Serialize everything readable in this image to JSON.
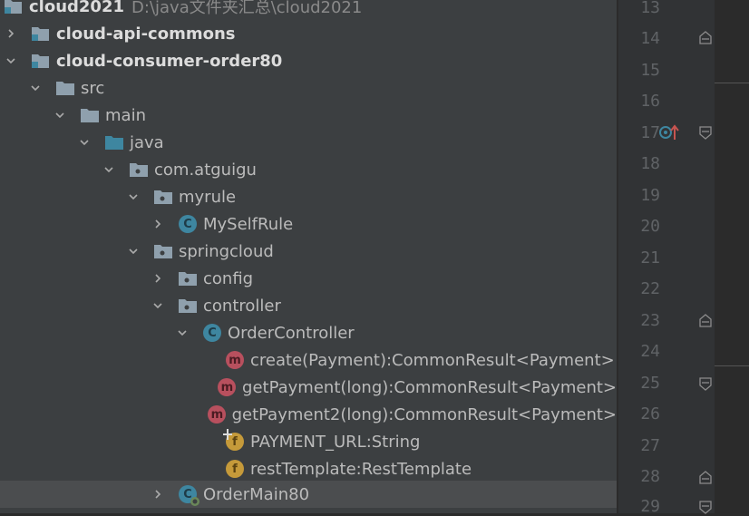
{
  "tree": {
    "rows": [
      {
        "label": "cloud2021",
        "path": "D:\\java文件夹汇总\\cloud2021",
        "icon": "module-folder-icon",
        "bold": true,
        "expanded": null
      },
      {
        "label": "cloud-api-commons",
        "icon": "module-folder-icon",
        "bold": true,
        "expanded": false
      },
      {
        "label": "cloud-consumer-order80",
        "icon": "module-folder-icon",
        "bold": true,
        "expanded": true
      },
      {
        "label": "src",
        "icon": "folder-icon",
        "expanded": true
      },
      {
        "label": "main",
        "icon": "folder-icon",
        "expanded": true
      },
      {
        "label": "java",
        "icon": "source-folder-icon",
        "expanded": true
      },
      {
        "label": "com.atguigu",
        "icon": "package-icon",
        "expanded": true
      },
      {
        "label": "myrule",
        "icon": "package-icon",
        "expanded": true
      },
      {
        "label": "MySelfRule",
        "icon": "class-icon",
        "expanded": false
      },
      {
        "label": "springcloud",
        "icon": "package-icon",
        "expanded": true
      },
      {
        "label": "config",
        "icon": "package-icon",
        "expanded": false
      },
      {
        "label": "controller",
        "icon": "package-icon",
        "expanded": true
      },
      {
        "label": "OrderController",
        "icon": "class-icon",
        "expanded": true
      },
      {
        "label": "create(Payment):CommonResult<Payment>",
        "icon": "method-icon",
        "expanded": null
      },
      {
        "label": "getPayment(long):CommonResult<Payment>",
        "icon": "method-icon",
        "expanded": null
      },
      {
        "label": "getPayment2(long):CommonResult<Payment>",
        "icon": "method-icon",
        "expanded": null
      },
      {
        "label": "PAYMENT_URL:String",
        "icon": "static-field-icon",
        "expanded": null
      },
      {
        "label": "restTemplate:RestTemplate",
        "icon": "field-icon",
        "expanded": null
      },
      {
        "label": "OrderMain80",
        "icon": "spring-boot-class-icon",
        "expanded": false,
        "selected": true
      }
    ]
  },
  "gutter": {
    "line_numbers": [
      "13",
      "14",
      "15",
      "16",
      "17",
      "18",
      "19",
      "20",
      "21",
      "22",
      "23",
      "24",
      "25",
      "26",
      "27",
      "28",
      "29"
    ]
  },
  "icon_letters": {
    "class": "C",
    "method": "m",
    "field": "f"
  }
}
